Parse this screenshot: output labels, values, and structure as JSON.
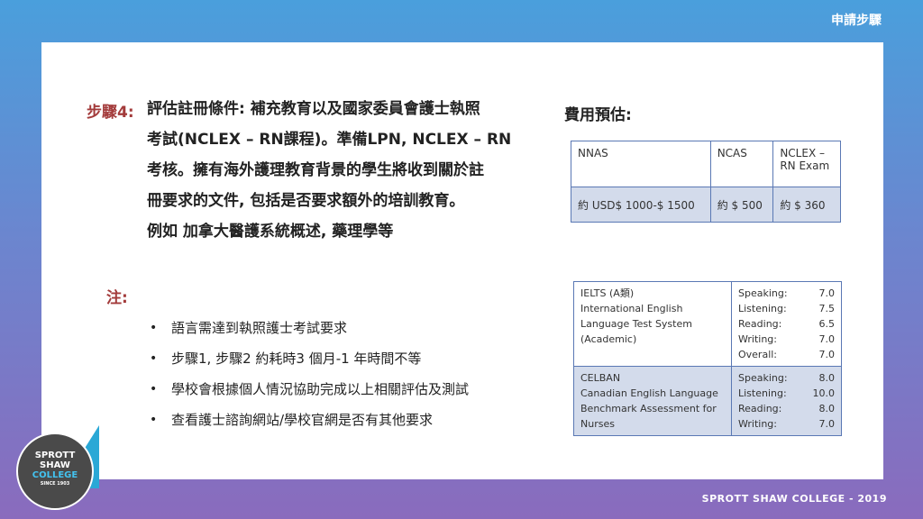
{
  "header": {
    "title": "申請步驟"
  },
  "step": {
    "label": "步驟4:",
    "lines": [
      "評估註冊條件: 補充教育以及國家委員會護士執照",
      "考試(NCLEX – RN課程)。準備LPN, NCLEX – RN",
      "考核。擁有海外護理教育背景的學生將收到關於註",
      "冊要求的文件, 包括是否要求額外的培訓教育。",
      "例如 加拿大醫護系統概述, 藥理學等"
    ]
  },
  "notes": {
    "label": "注:",
    "bullet": "•",
    "items": [
      "語言需達到執照護士考試要求",
      "步驟1, 步驟2 約耗時3 個月-1 年時間不等",
      "學校會根據個人情況協助完成以上相關評估及測試",
      "查看護士諮詢網站/學校官網是否有其他要求"
    ]
  },
  "fees": {
    "heading": "費用預估:",
    "headers": [
      "NNAS",
      "NCAS",
      "NCLEX –\nRN Exam"
    ],
    "values": [
      "約 USD$ 1000-$ 1500",
      "約 $ 500",
      "約 $ 360"
    ]
  },
  "language_tests": [
    {
      "name_lines": [
        "IELTS (A類)",
        "International English",
        "Language Test System",
        "(Academic)"
      ],
      "scores": [
        {
          "label": "Speaking:",
          "value": "7.0"
        },
        {
          "label": "Listening:",
          "value": "7.5"
        },
        {
          "label": "Reading:",
          "value": "6.5"
        },
        {
          "label": "Writing:",
          "value": "7.0"
        },
        {
          "label": "Overall:",
          "value": "7.0"
        }
      ]
    },
    {
      "name_lines": [
        "CELBAN",
        "Canadian English Language",
        "Benchmark Assessment for",
        "Nurses"
      ],
      "scores": [
        {
          "label": "Speaking:",
          "value": "8.0"
        },
        {
          "label": "Listening:",
          "value": "10.0"
        },
        {
          "label": "Reading:",
          "value": "8.0"
        },
        {
          "label": "Writing:",
          "value": "7.0"
        }
      ]
    }
  ],
  "logo": {
    "line1": "SPROTT",
    "line2": "SHAW",
    "line3": "COLLEGE",
    "line4": "SINCE 1903"
  },
  "footer": {
    "text": "SPROTT SHAW COLLEGE - 2019"
  },
  "colors": {
    "accent": "#a33b3b",
    "table_border": "#5a78b4",
    "table_fill": "#d3dbeb"
  }
}
